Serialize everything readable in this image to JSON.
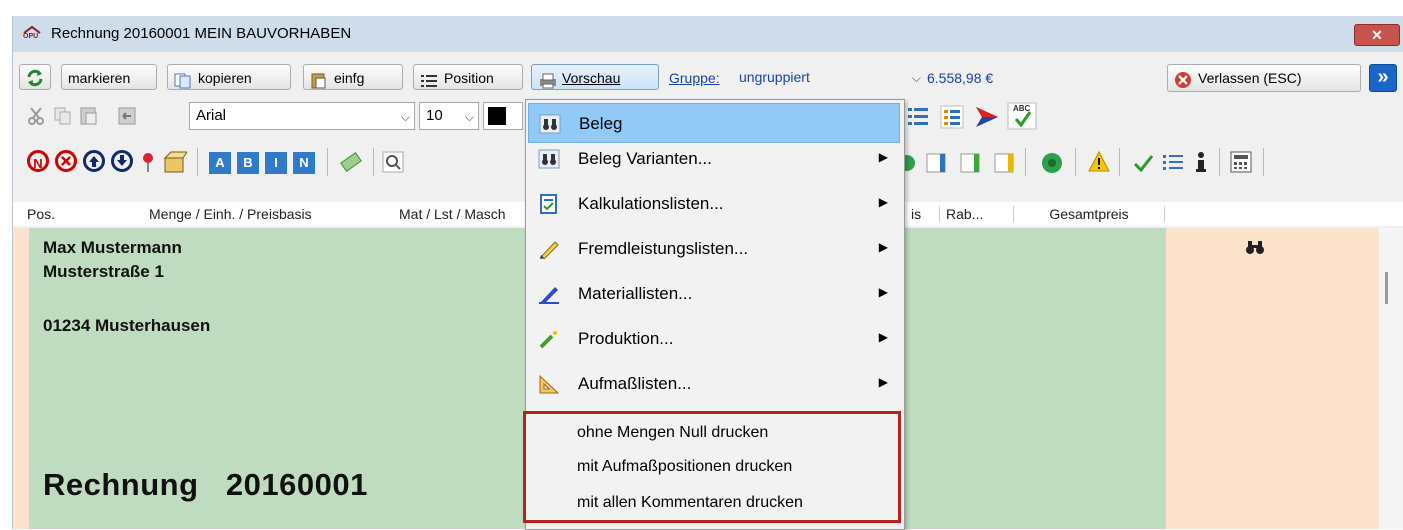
{
  "window": {
    "title": "Rechnung 20160001 MEIN BAUVORHABEN",
    "logo_text": "OPU",
    "close_glyph": "✕"
  },
  "toolbar1": {
    "refresh_icon": "refresh-icon",
    "markieren": "markieren",
    "kopieren": "kopieren",
    "einfg": "einfg",
    "position": "Position",
    "vorschau": "Vorschau",
    "gruppe_label": "Gruppe:",
    "gruppe_value": "ungruppiert",
    "total": "6.558,98 €",
    "verlassen": "Verlassen (ESC)",
    "more_glyph": "»"
  },
  "toolbar2": {
    "font": "Arial",
    "size": "10",
    "spell_label": "ABC"
  },
  "toolbar3": {
    "n_glyph": "N",
    "abin": [
      "A",
      "B",
      "I",
      "N"
    ]
  },
  "columns": {
    "pos": "Pos.",
    "menge": "Menge / Einh. / Preisbasis",
    "mat": "Mat / Lst / Masch",
    "preis_tail": "is",
    "rab": "Rab...",
    "gesamt": "Gesamtpreis"
  },
  "document": {
    "name": "Max Mustermann",
    "street": "Musterstraße 1",
    "city": "01234 Musterhausen",
    "heading": "Rechnung   20160001"
  },
  "menu": {
    "items": [
      {
        "label": "Beleg",
        "icon": "binoculars-print-icon",
        "submenu": false,
        "highlighted": true
      },
      {
        "label": "Beleg Varianten...",
        "icon": "binoculars-print-icon",
        "submenu": true
      },
      {
        "label": "Kalkulationslisten...",
        "icon": "calc-list-icon",
        "submenu": true
      },
      {
        "label": "Fremdleistungslisten...",
        "icon": "pencil-icon",
        "submenu": true
      },
      {
        "label": "Materiallisten...",
        "icon": "pen-icon",
        "submenu": true
      },
      {
        "label": "Produktion...",
        "icon": "wand-icon",
        "submenu": true
      },
      {
        "label": "Aufmaßlisten...",
        "icon": "triangle-ruler-icon",
        "submenu": true
      }
    ],
    "print_options": [
      "ohne Mengen Null drucken",
      "mit Aufmaßpositionen drucken",
      "mit allen Kommentaren drucken"
    ],
    "submenu_glyph": "▶"
  },
  "colors": {
    "green_area": "#c0dcc0",
    "peach_area": "#fde3cb",
    "highlight": "#91c9f7",
    "red_frame": "#b62323"
  }
}
